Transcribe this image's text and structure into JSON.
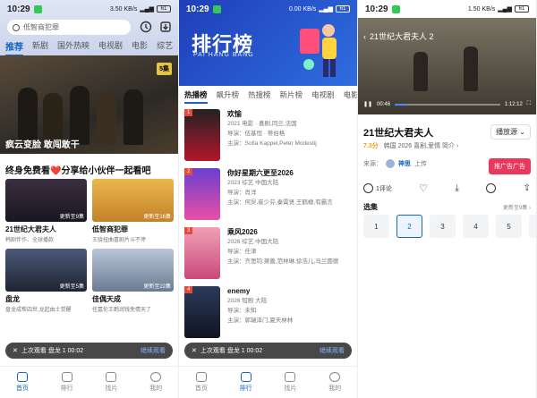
{
  "status": {
    "time1": "10:29",
    "time2": "10:29",
    "time3": "10:29",
    "battery": "61",
    "net1": "3.50 KB/s",
    "net2": "0.00 KB/s",
    "net3": "1.50 KB/s",
    "accent_green": "#34c759"
  },
  "home": {
    "search_placeholder": "低智商犯罪",
    "tabs": [
      "推荐",
      "新剧",
      "国外热映",
      "电视剧",
      "电影",
      "综艺"
    ],
    "banner_caption": "疯云变脸 敢闯敢干",
    "banner_badge": "5集",
    "promo_title": "终身免费看❤️分享给小伙伴一起看吧",
    "cards": [
      {
        "title": "21世纪大君夫人",
        "desc": "韩剧伴作、全球播款",
        "upd": "更新至9集"
      },
      {
        "title": "低智商犯罪",
        "desc": "王骁扭曲喜剧片斗不停",
        "upd": "更新至16集"
      },
      {
        "title": "盘龙",
        "desc": "盘龙成帮四世,龙起由士觉醒",
        "upd": "更新至5集"
      },
      {
        "title": "佳偶天成",
        "desc": "任嘉伦王鹤润钱免情天了",
        "upd": "更新至22集"
      }
    ],
    "resume_text": "上次观看 盘龙 1 00:02",
    "resume_action": "继续观看"
  },
  "rank": {
    "title": "排行榜",
    "subtitle": "PAI HANG BANG",
    "tabs": [
      "热播榜",
      "飙升榜",
      "热搜榜",
      "新片榜",
      "电视剧",
      "电影"
    ],
    "items": [
      {
        "rank": "1",
        "name": "欢愉",
        "meta": "2021  电影 · 喜剧,同兰,法国",
        "director": "导演：伍基恒 · 蒂伯格",
        "cast": "主演：Sofia Kappel,Peter Modestij"
      },
      {
        "rank": "2",
        "name": "你好星期六更至2026",
        "meta": "2023  综艺  中国大陆",
        "director": "导演：肖洋",
        "cast": "主演：何炅,崔少芬,秦霄贤,王鹤棣,有霸言"
      },
      {
        "rank": "3",
        "name": "乘风2026",
        "meta": "2026  综艺  中国大陆",
        "director": "导演：任津",
        "cast": "主演：齐思钧,萧蔷,范林琳,徐浩儿,马兰圆德"
      },
      {
        "rank": "4",
        "name": "enemy",
        "meta": "2026  短剧  大陆",
        "director": "导演：未知",
        "cast": "主演：郭瑞泽门,夏天林林"
      }
    ],
    "resume_text": "上次观看 盘龙 1 00:02",
    "resume_action": "继续观看"
  },
  "detail": {
    "player_title": "21世纪大君夫人 2",
    "time_current": "00:46",
    "time_total": "1:12:12",
    "progress": 0.11,
    "title": "21世纪大君夫人",
    "score": "7.3分",
    "meta": "韩国  2026  喜剧,爱情  简介 ›",
    "source_button": "播放源 ⌄",
    "source_label": "来源：",
    "uploader": "神思",
    "upload_suffix": "上传",
    "promote_button": "推广告广告",
    "comments": "1评论",
    "episodes_label": "选集",
    "episodes_more": "更新至9集 ›",
    "episodes": [
      "1",
      "2",
      "3",
      "4",
      "5",
      "6"
    ],
    "selected_episode": "2"
  },
  "tabbar": [
    "首页",
    "排行",
    "找片",
    "我的"
  ],
  "colors": {
    "brand_blue": "#1565c0",
    "rank_red": "#e64a3b",
    "promote_pink": "#e8395a"
  }
}
